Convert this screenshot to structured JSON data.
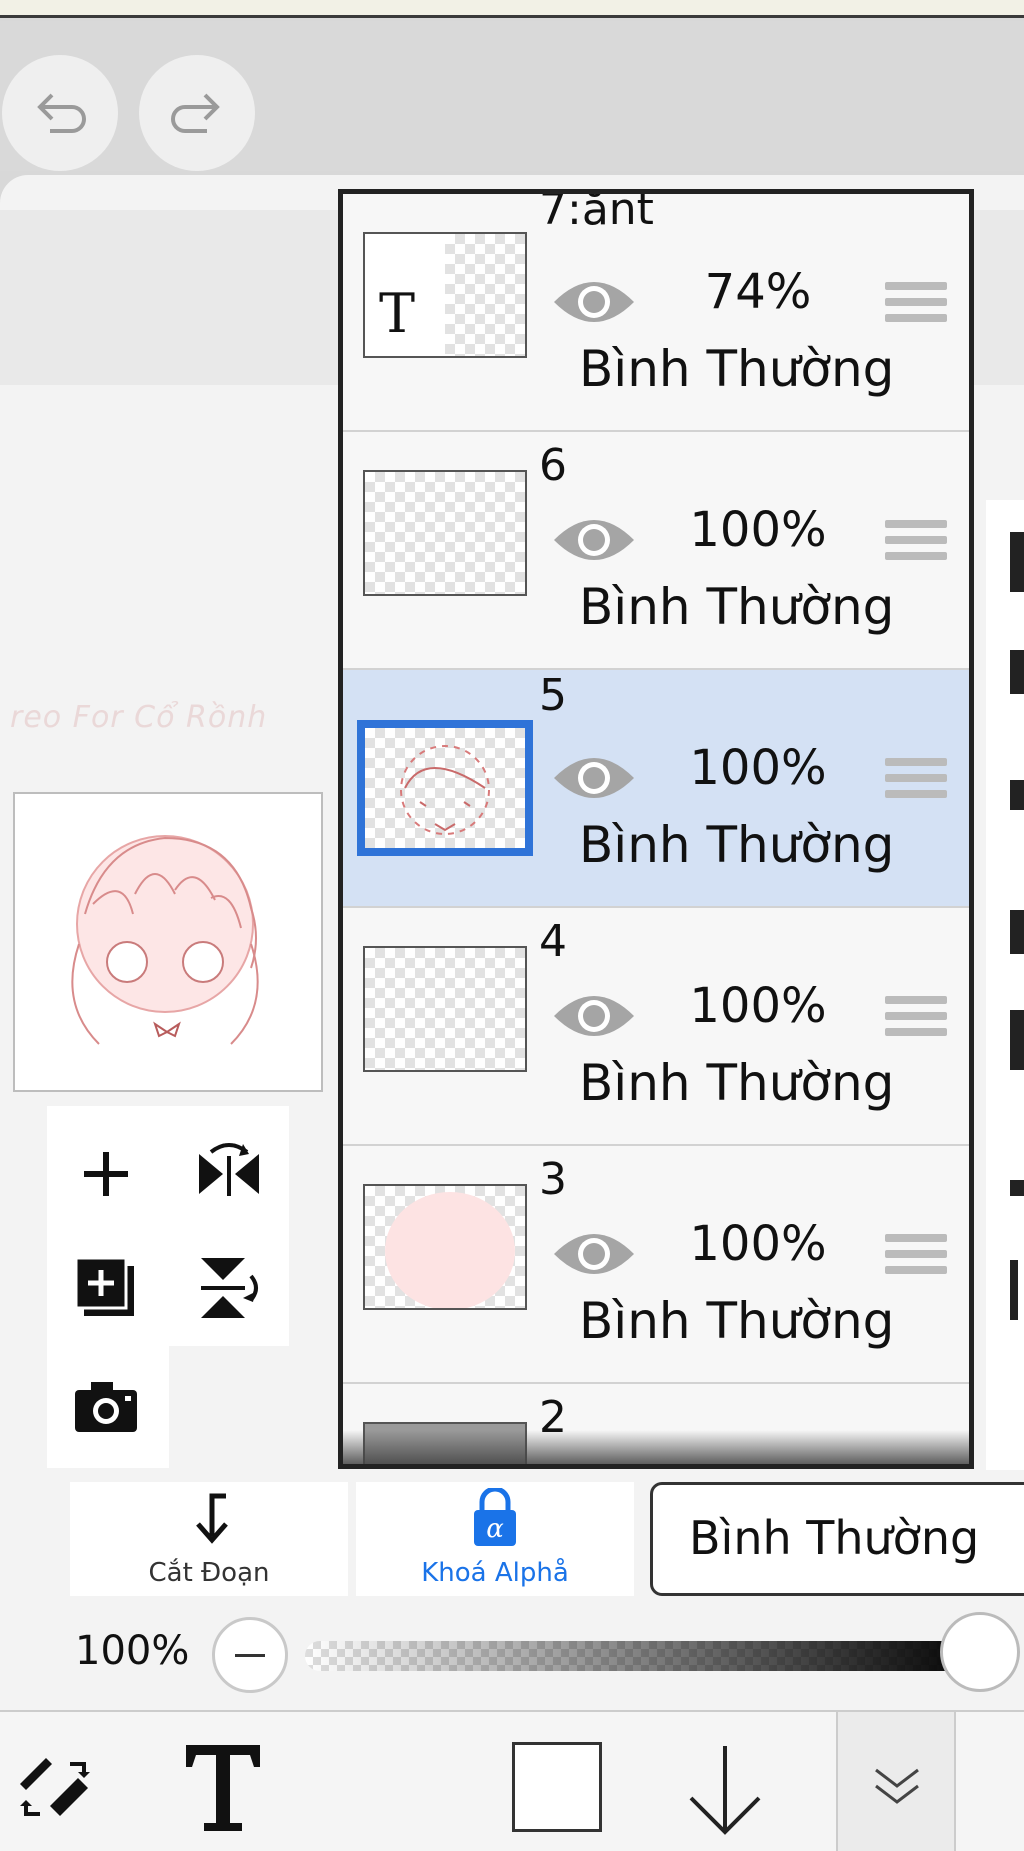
{
  "toolbar": {
    "undo_icon": "undo-icon",
    "redo_icon": "redo-icon"
  },
  "canvas": {
    "ghost_text": "reo For Cổ Rồnh"
  },
  "layers": [
    {
      "number": "7:ănt",
      "opacity": "74%",
      "blend_mode": "Bình Thường",
      "type": "text",
      "thumb_glyph": "T",
      "visible": true,
      "selected": false
    },
    {
      "number": "6",
      "opacity": "100%",
      "blend_mode": "Bình Thường",
      "type": "raster",
      "visible": true,
      "selected": false
    },
    {
      "number": "5",
      "opacity": "100%",
      "blend_mode": "Bình Thường",
      "type": "raster",
      "visible": true,
      "selected": true
    },
    {
      "number": "4",
      "opacity": "100%",
      "blend_mode": "Bình Thường",
      "type": "raster",
      "visible": true,
      "selected": false
    },
    {
      "number": "3",
      "opacity": "100%",
      "blend_mode": "Bình Thường",
      "type": "raster",
      "visible": true,
      "selected": false
    },
    {
      "number": "2",
      "opacity": "",
      "blend_mode": "",
      "type": "raster",
      "visible": true,
      "selected": false
    }
  ],
  "layer_actions": {
    "clip_label": "Cắt Đoạn",
    "alpha_lock_label": "Khoá Alphå",
    "blend_mode_value": "Bình Thường",
    "accent_color": "#1a73e8"
  },
  "opacity_slider": {
    "value_label": "100%",
    "value": 1.0
  },
  "colors": {
    "selected_layer_bg": "#d4e1f4",
    "selected_layer_border": "#2f73d8",
    "current_color": "#ffffff"
  }
}
